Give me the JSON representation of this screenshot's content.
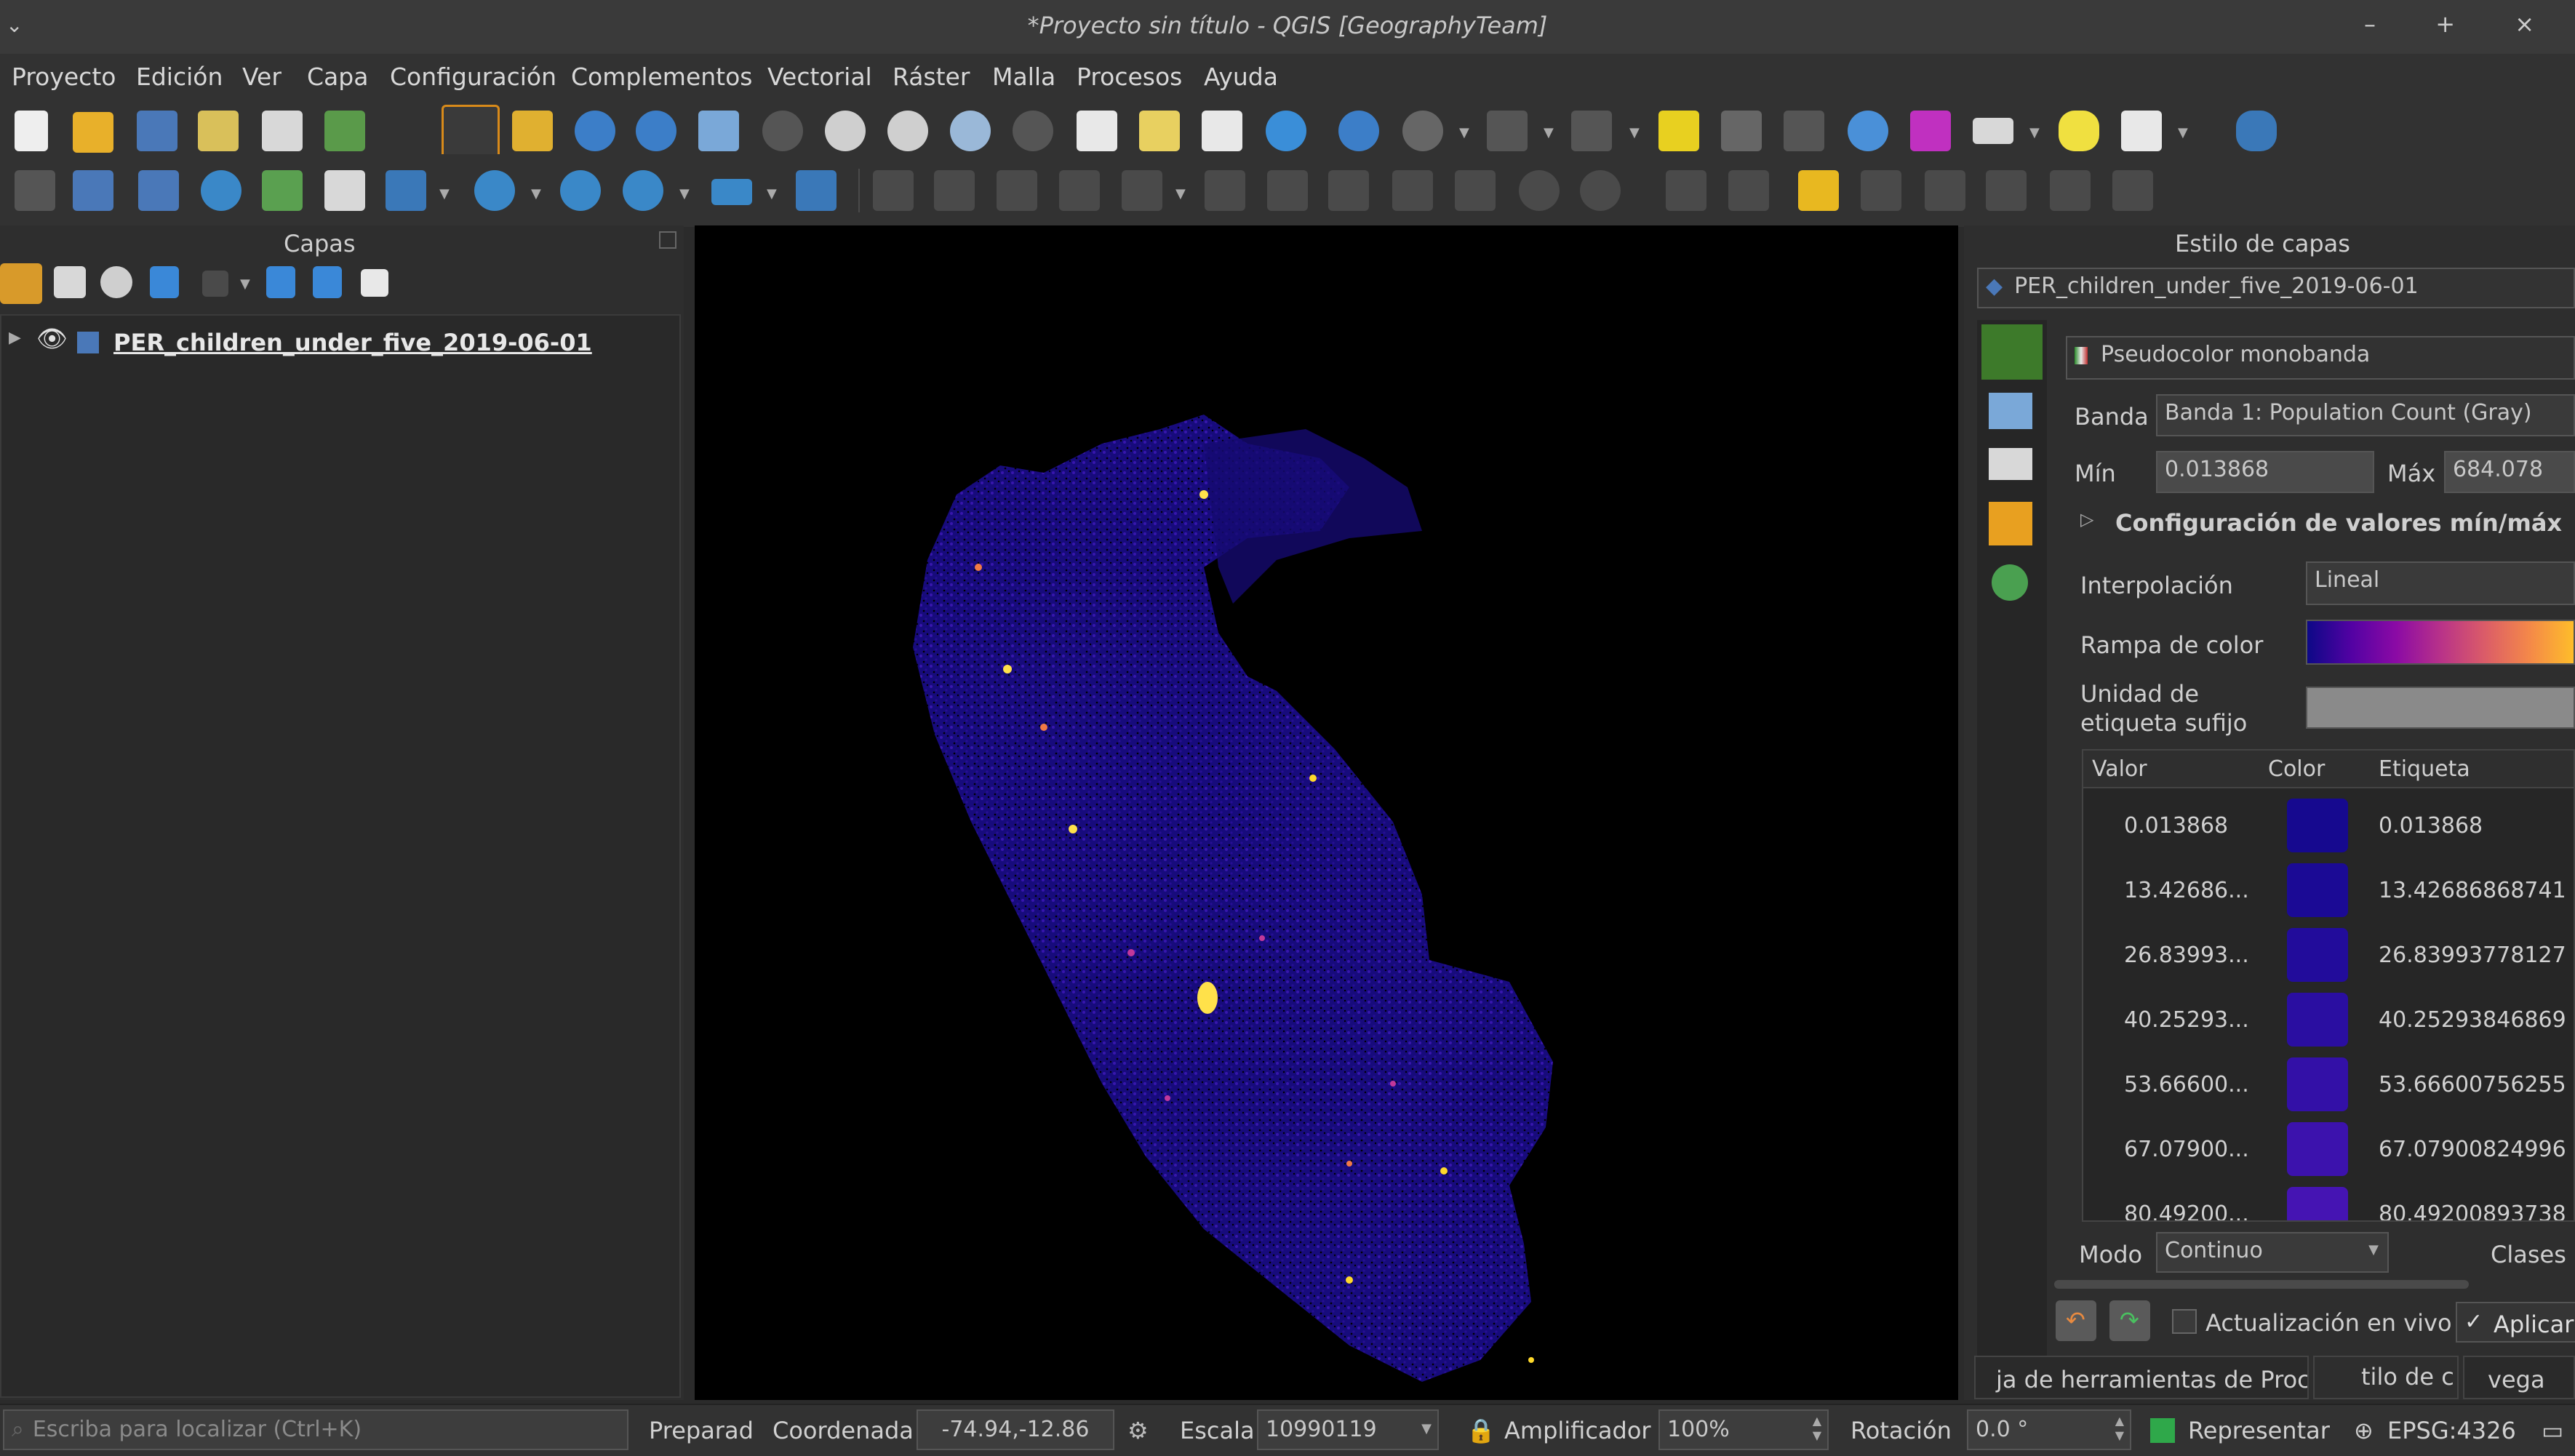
{
  "window": {
    "title": "*Proyecto sin título - QGIS [GeographyTeam]",
    "controls": "– + ×"
  },
  "menu": [
    "Proyecto",
    "Edición",
    "Ver",
    "Capa",
    "Configuración",
    "Complementos",
    "Vectorial",
    "Ráster",
    "Malla",
    "Procesos",
    "Ayuda"
  ],
  "layers_panel": {
    "title": "Capas",
    "layers": [
      {
        "name": "PER_children_under_five_2019-06-01",
        "visible": true
      }
    ]
  },
  "map": {
    "background": "#000000",
    "ramp_colors": [
      "#1b0a9e",
      "#3d14b8",
      "#7a1fc4",
      "#c2389a",
      "#f07a45",
      "#ffd92a"
    ]
  },
  "style_panel": {
    "title": "Estilo de capas",
    "layer_selector": "PER_children_under_five_2019-06-01",
    "renderer": "Pseudocolor monobanda",
    "band_label": "Banda",
    "band_value": "Banda 1: Population Count (Gray)",
    "min_label": "Mín",
    "min_value": "0.013868",
    "max_label": "Máx",
    "max_value": "684.078",
    "minmax_section": "Configuración de valores mín/máx",
    "interpolation_label": "Interpolación",
    "interpolation_value": "Lineal",
    "color_ramp_label": "Rampa de color",
    "unit_suffix_label": "Unidad de etiqueta sufijo",
    "table_headers": [
      "Valor",
      "Color",
      "Etiqueta"
    ],
    "table_rows": [
      {
        "value": "0.013868",
        "color": "#16098f",
        "label": "0.013868"
      },
      {
        "value": "13.42686...",
        "color": "#1b0a95",
        "label": "13.42686868741"
      },
      {
        "value": "26.83993...",
        "color": "#220c9b",
        "label": "26.83993778127"
      },
      {
        "value": "40.25293...",
        "color": "#2a0ea1",
        "label": "40.25293846869"
      },
      {
        "value": "53.66600...",
        "color": "#3310a7",
        "label": "53.66600756255"
      },
      {
        "value": "67.07900...",
        "color": "#3c12ad",
        "label": "67.07900824996"
      },
      {
        "value": "80.49200...",
        "color": "#4514b3",
        "label": "80.49200893738"
      }
    ],
    "mode_label": "Modo",
    "mode_value": "Continuo",
    "classes_label": "Clases",
    "live_update_label": "Actualización en vivo",
    "apply_label": "Aplicar",
    "bottom_tabs": [
      "ja de herramientas de Proc",
      "tilo de c",
      "vega"
    ]
  },
  "statusbar": {
    "search_placeholder": "Escriba para localizar (Ctrl+K)",
    "ready": "Preparad",
    "coord_label": "Coordenada",
    "coord_value": "-74.94,-12.86",
    "scale_label": "Escala",
    "scale_value": "10990119",
    "magnifier_label": "Amplificador",
    "magnifier_value": "100%",
    "rotation_label": "Rotación",
    "rotation_value": "0.0 °",
    "render_label": "Representar",
    "crs": "EPSG:4326"
  }
}
